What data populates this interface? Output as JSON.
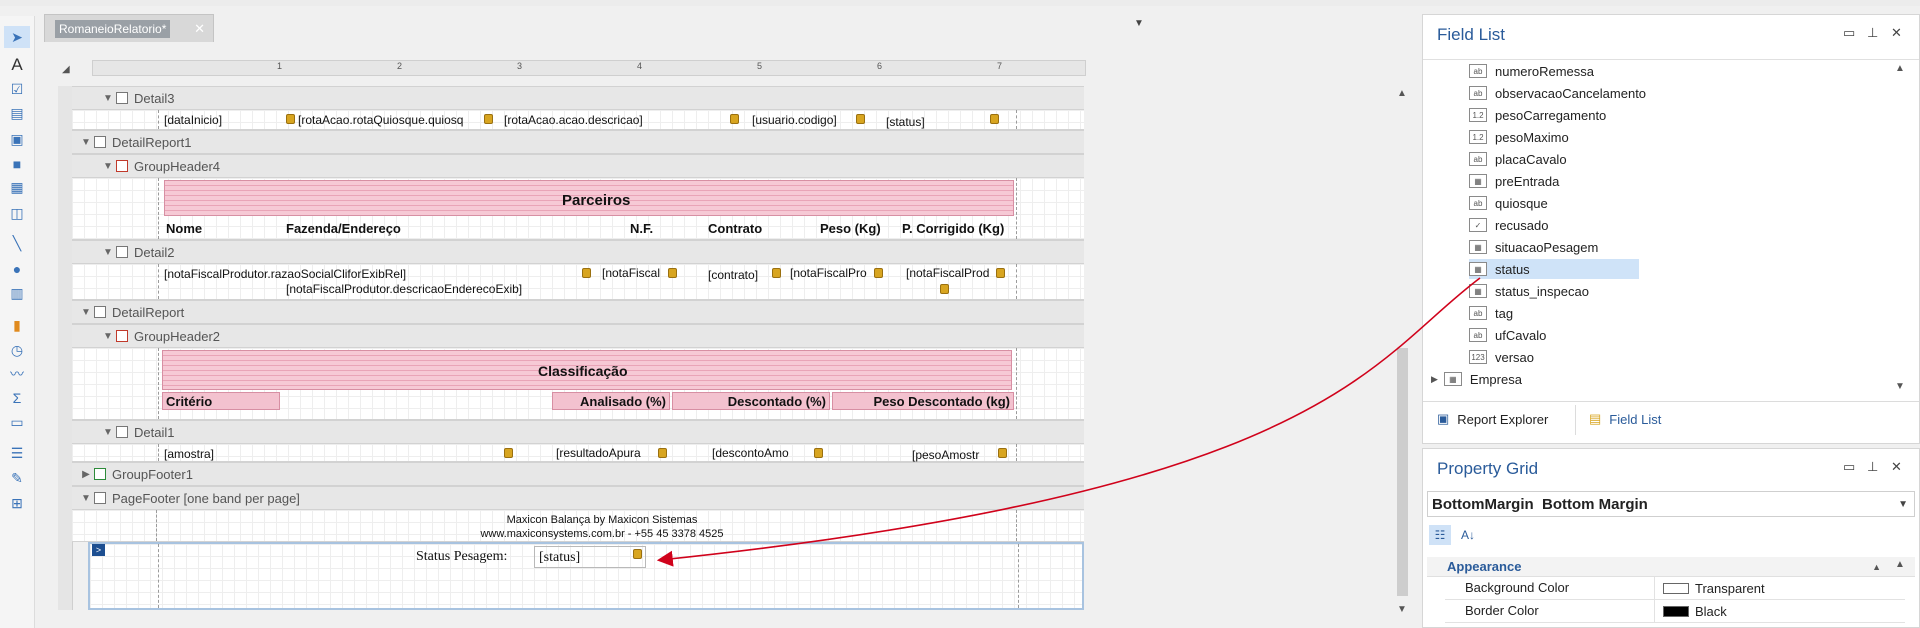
{
  "document": {
    "tab_title": "RomaneioRelatorio*",
    "close": "✕"
  },
  "ruler": {
    "marks": [
      "1",
      "2",
      "3",
      "4",
      "5",
      "6",
      "7"
    ]
  },
  "bands": {
    "detail3": "Detail3",
    "detail_report1": "DetailReport1",
    "group_header4": "GroupHeader4",
    "detail2": "Detail2",
    "detail_report": "DetailReport",
    "group_header2": "GroupHeader2",
    "detail1": "Detail1",
    "group_footer1": "GroupFooter1",
    "page_footer": "PageFooter [one band per page]"
  },
  "detail3_fields": [
    "[dataInicio]",
    "[rotaAcao.rotaQuiosque.quiosq",
    "[rotaAcao.acao.descricao]",
    "[usuario.codigo]",
    "[status]"
  ],
  "parceiros": {
    "title": "Parceiros",
    "columns": [
      "Nome",
      "Fazenda/Endereço",
      "N.F.",
      "Contrato",
      "Peso (Kg)",
      "P. Corrigido (Kg)"
    ]
  },
  "detail2_fields": [
    "[notaFiscalProdutor.razaoSocialCliforExibRel]",
    "[notaFiscal",
    "[contrato]",
    "[notaFiscalPro",
    "[notaFiscalProd",
    "[notaFiscalProdutor.descricaoEnderecoExib]"
  ],
  "classificacao": {
    "title": "Classificação",
    "columns": [
      "Critério",
      "Analisado (%)",
      "Descontado (%)",
      "Peso Descontado (kg)"
    ]
  },
  "detail1_fields": [
    "[amostra]",
    "[resultadoApura",
    "[descontoAmo",
    "[pesoAmostr"
  ],
  "footer": {
    "line1": "Maxicon Balança by Maxicon Sistemas",
    "line2": "www.maxiconsystems.com.br - +55 45 3378 4525",
    "status_label": "Status Pesagem:",
    "status_field": "[status]"
  },
  "field_list": {
    "title": "Field List",
    "items": [
      {
        "label": "numeroRemessa",
        "icon": "ab"
      },
      {
        "label": "observacaoCancelamento",
        "icon": "ab"
      },
      {
        "label": "pesoCarregamento",
        "icon": "1.2"
      },
      {
        "label": "pesoMaximo",
        "icon": "1.2"
      },
      {
        "label": "placaCavalo",
        "icon": "ab"
      },
      {
        "label": "preEntrada",
        "icon": "tbl"
      },
      {
        "label": "quiosque",
        "icon": "ab"
      },
      {
        "label": "recusado",
        "icon": "chk"
      },
      {
        "label": "situacaoPesagem",
        "icon": "tbl"
      },
      {
        "label": "status",
        "icon": "tbl"
      },
      {
        "label": "status_inspecao",
        "icon": "tbl"
      },
      {
        "label": "tag",
        "icon": "ab"
      },
      {
        "label": "ufCavalo",
        "icon": "ab"
      },
      {
        "label": "versao",
        "icon": "123"
      }
    ],
    "root_item": "Empresa",
    "tabs": [
      "Report Explorer",
      "Field List"
    ]
  },
  "property_grid": {
    "title": "Property Grid",
    "selector_name": "BottomMargin",
    "selector_type": "Bottom Margin",
    "category": "Appearance",
    "rows": [
      {
        "key": "Background Color",
        "value": "Transparent",
        "swatch": "#ffffff"
      },
      {
        "key": "Border Color",
        "value": "Black",
        "swatch": "#000000"
      }
    ]
  },
  "colors": {
    "accent": "#2a5b9a",
    "band_pink": "#f3c2cf",
    "arrow": "#d0021b"
  }
}
